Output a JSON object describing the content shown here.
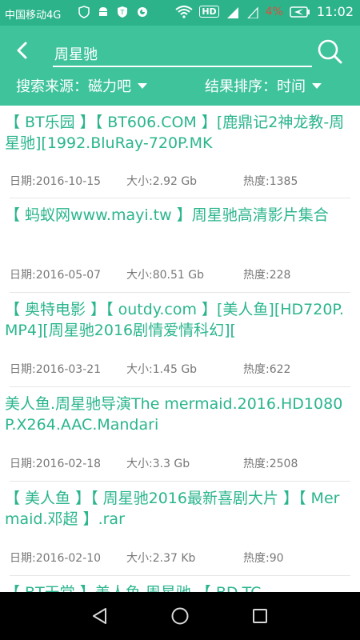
{
  "status_bar": {
    "carrier": "中国移动4G",
    "network_type": "4G",
    "battery_percent": "4%",
    "time": "11:02",
    "hd_label": "HD"
  },
  "header": {
    "search_value": "周星驰",
    "filters": {
      "source_label": "搜索来源：磁力吧",
      "sort_label": "结果排序：时间"
    }
  },
  "results": [
    {
      "title": "【 BT乐园 】【 BT606.COM 】[鹿鼎记2神龙教-周星驰][1992.BluRay-720P.MK",
      "date": "日期:2016-10-15",
      "size": "大小:2.92 Gb",
      "heat": "热度:1385"
    },
    {
      "title": "【 蚂蚁网www.mayi.tw 】周星驰高清影片集合",
      "date": "日期:2016-05-07",
      "size": "大小:80.51 Gb",
      "heat": "热度:228"
    },
    {
      "title": "【 奥特电影 】【 outdy.com 】[美人鱼][HD720P.MP4][周星驰2016剧情爱情科幻][",
      "date": "日期:2016-03-21",
      "size": "大小:1.45 Gb",
      "heat": "热度:622"
    },
    {
      "title": "美人鱼.周星驰导演The mermaid.2016.HD1080P.X264.AAC.Mandari",
      "date": "日期:2016-02-18",
      "size": "大小:3.3 Gb",
      "heat": "热度:2508"
    },
    {
      "title": "【 美人鱼 】【 周星驰2016最新喜剧大片 】【 Mermaid.邓超 】.rar",
      "date": "日期:2016-02-10",
      "size": "大小:2.37 Kb",
      "heat": "热度:90"
    },
    {
      "title": "【 BT天堂 】美人鱼 周星驰 【 BD-TC",
      "date": "",
      "size": "",
      "heat": ""
    }
  ],
  "colors": {
    "status_bar": "#2db38a",
    "header": "#3ec39b",
    "accent_text": "#2bb58d",
    "meta_text": "#777777",
    "nav_bar": "#000000"
  },
  "icons": {
    "back": "arrow-left-icon",
    "search": "magnifier-icon",
    "dropdown": "caret-down-icon",
    "nav_back": "triangle-back-icon",
    "nav_home": "circle-home-icon",
    "nav_recent": "square-recent-icon"
  }
}
